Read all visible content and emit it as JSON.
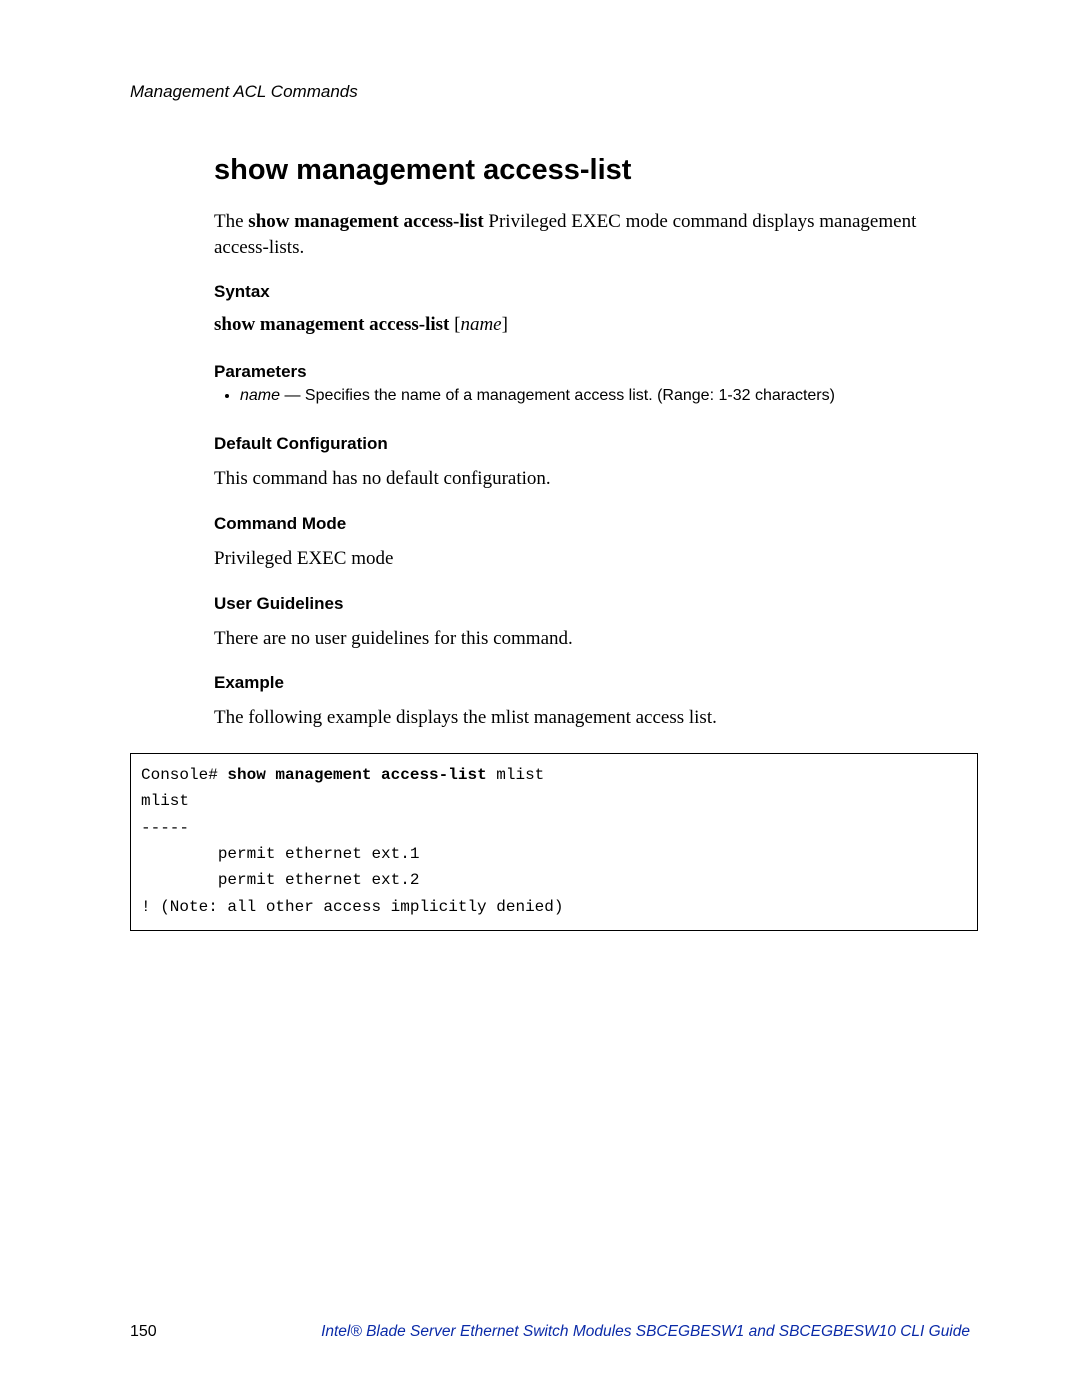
{
  "header": {
    "running": "Management ACL Commands"
  },
  "title": "show management access-list",
  "intro": {
    "prefix": "The ",
    "bold": "show management access-list",
    "rest": " Privileged EXEC mode command displays management access-lists."
  },
  "sections": {
    "syntax": {
      "heading": "Syntax",
      "cmd": "show management access-list",
      "arg_open": " [",
      "arg": "name",
      "arg_close": "]"
    },
    "parameters": {
      "heading": "Parameters",
      "items": [
        {
          "name": "name",
          "sep": " — ",
          "desc": "Specifies the name of a management access list. (Range: 1-32 characters)"
        }
      ]
    },
    "default_config": {
      "heading": "Default Configuration",
      "body": "This command has no default configuration."
    },
    "command_mode": {
      "heading": "Command Mode",
      "body": "Privileged EXEC mode"
    },
    "user_guidelines": {
      "heading": "User Guidelines",
      "body": "There are no user guidelines for this command."
    },
    "example": {
      "heading": "Example",
      "body": "The following example displays the mlist management access list."
    }
  },
  "code": {
    "l1a": "Console# ",
    "l1b": "show management access-list",
    "l1c": " mlist",
    "l2": "mlist",
    "l3": "-----",
    "l4": "        permit ethernet ext.1",
    "l5": "        permit ethernet ext.2",
    "l6": "! (Note: all other access implicitly denied)"
  },
  "footer": {
    "page": "150",
    "title": "Intel® Blade Server Ethernet Switch Modules SBCEGBESW1 and SBCEGBESW10 CLI Guide"
  }
}
